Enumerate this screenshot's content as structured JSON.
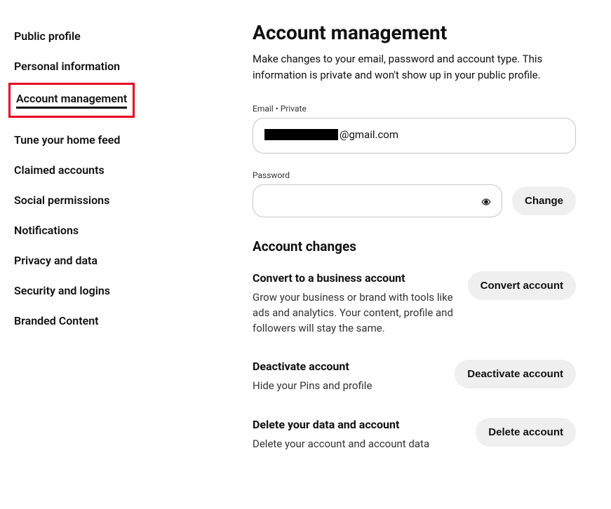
{
  "sidebar": {
    "items": [
      {
        "label": "Public profile"
      },
      {
        "label": "Personal information"
      },
      {
        "label": "Account management",
        "active": true
      },
      {
        "label": "Tune your home feed"
      },
      {
        "label": "Claimed accounts"
      },
      {
        "label": "Social permissions"
      },
      {
        "label": "Notifications"
      },
      {
        "label": "Privacy and data"
      },
      {
        "label": "Security and logins"
      },
      {
        "label": "Branded Content"
      }
    ]
  },
  "main": {
    "title": "Account management",
    "subtitle": "Make changes to your email, password and account type. This information is private and won't show up in your public profile.",
    "email_label": "Email • Private",
    "email_suffix": "@gmail.com",
    "password_label": "Password",
    "password_value": "",
    "change_button": "Change",
    "changes_heading": "Account changes",
    "convert": {
      "title": "Convert to a business account",
      "desc": "Grow your business or brand with tools like ads and analytics. Your content, profile and followers will stay the same.",
      "button": "Convert account"
    },
    "deactivate": {
      "title": "Deactivate account",
      "desc": "Hide your Pins and profile",
      "button": "Deactivate account"
    },
    "delete": {
      "title": "Delete your data and account",
      "desc": "Delete your account and account data",
      "button": "Delete account"
    }
  }
}
